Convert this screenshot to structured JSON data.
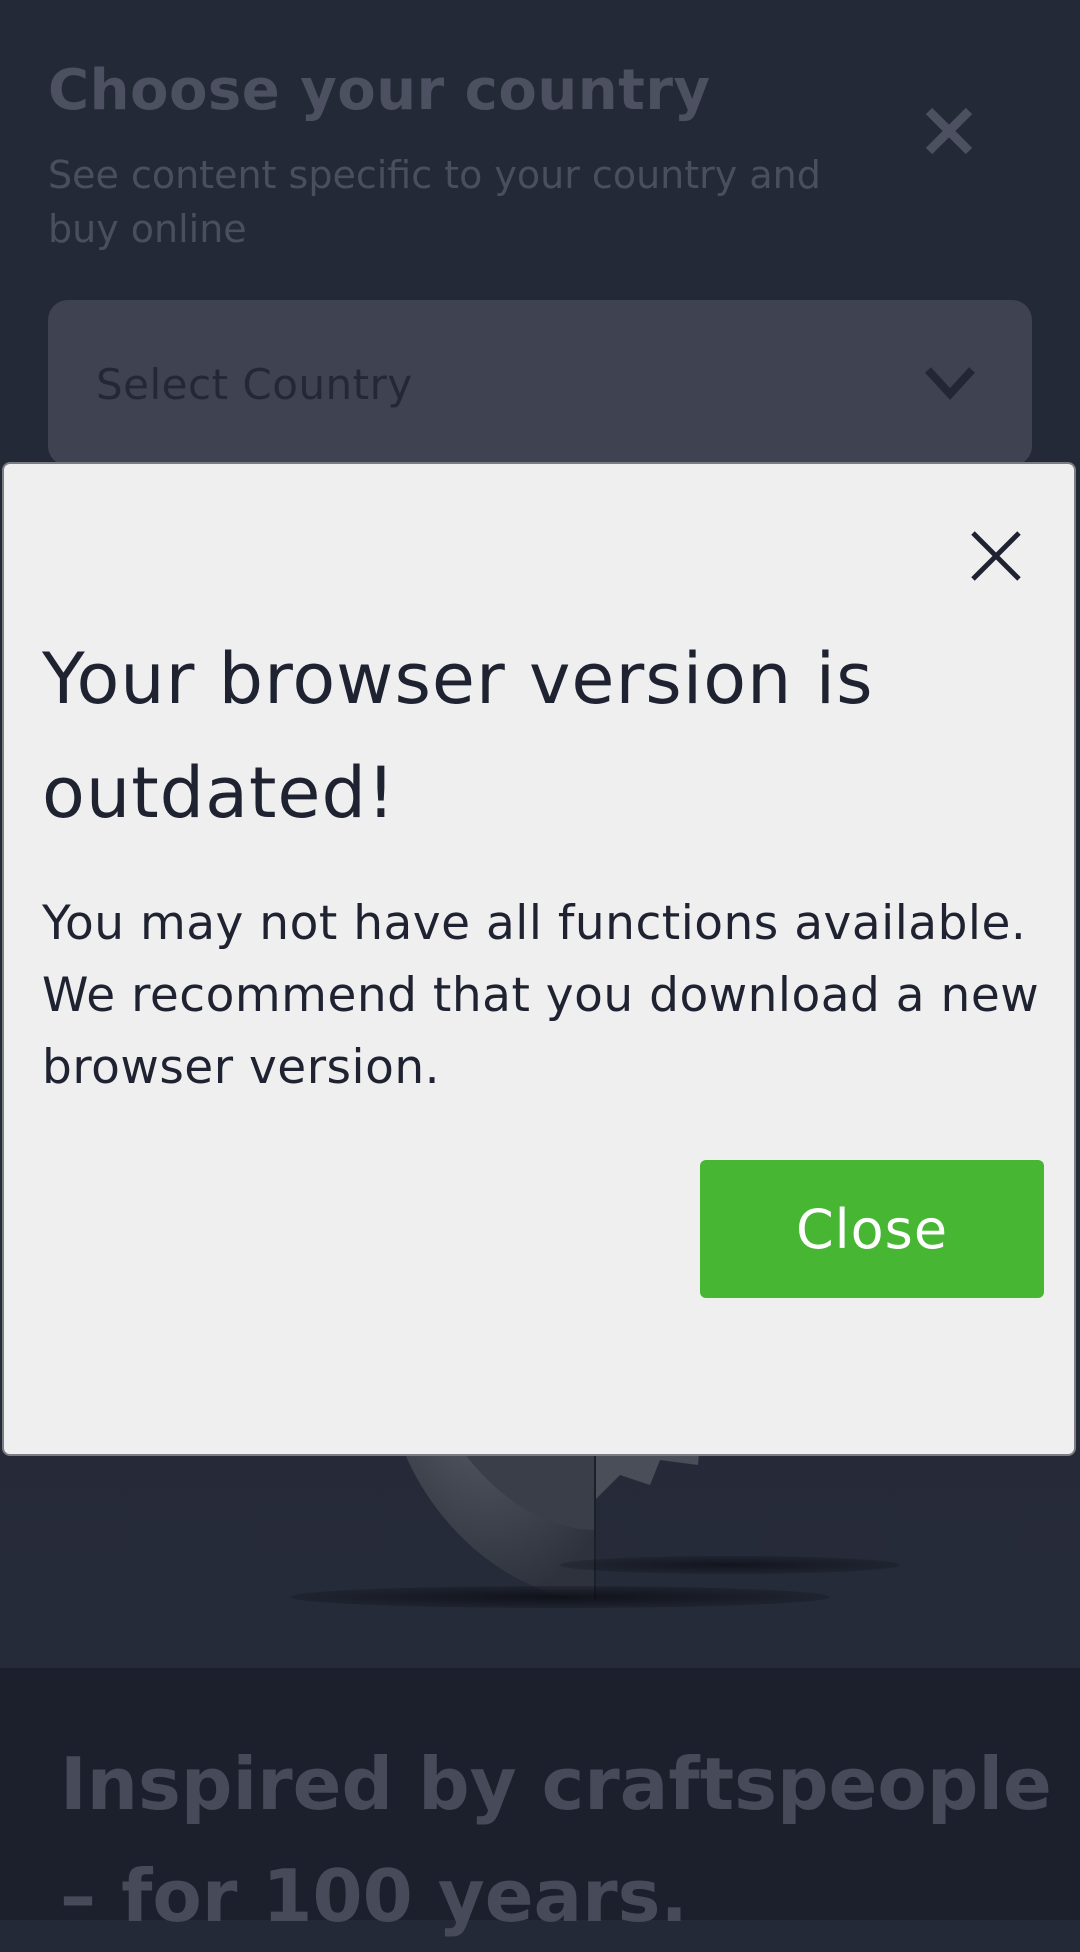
{
  "country_chooser": {
    "title": "Choose your country",
    "subtitle": "See content specific to your country and buy online",
    "select_placeholder": "Select Country",
    "close_icon": "close-icon",
    "chevron_icon": "chevron-down-icon"
  },
  "page": {
    "headline": "Inspired by craftspeople – for 100 years."
  },
  "browser_warning": {
    "title": "Your browser version is outdated!",
    "message": "You may not have all functions available. We recommend that you download a new browser version.",
    "close_button_label": "Close",
    "close_icon": "close-icon"
  },
  "colors": {
    "page_background": "#242937",
    "modal_background": "#efeff0",
    "accent_green": "#46b633",
    "text_dark": "#1f2331"
  }
}
